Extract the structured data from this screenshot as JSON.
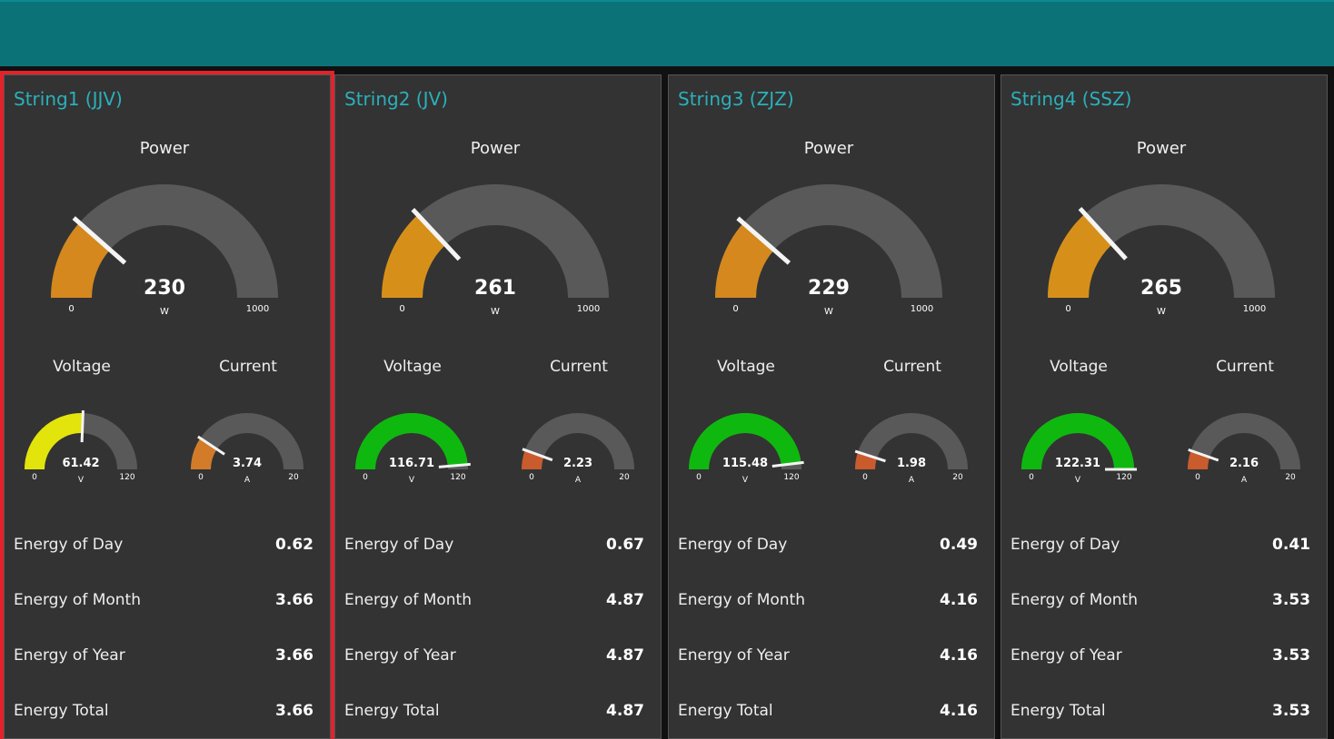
{
  "labels": {
    "power": "Power",
    "voltage": "Voltage",
    "current": "Current",
    "day": "Energy of Day",
    "month": "Energy of Month",
    "year": "Energy of Year",
    "total": "Energy Total"
  },
  "colors": {
    "header": "#0b7378",
    "title": "#2bb0bb",
    "track": "#595959",
    "selection": "#e3222a"
  },
  "strings": [
    {
      "title": "String1 (JJV)",
      "selected": true,
      "power": {
        "value": 230,
        "display": "230",
        "unit": "W",
        "min": "0",
        "max": "1000",
        "maxv": 1000,
        "color": "#d4881e"
      },
      "voltage": {
        "value": 61.42,
        "display": "61.42",
        "unit": "V",
        "min": "0",
        "max": "120",
        "maxv": 120,
        "color": "#e2e40b"
      },
      "current": {
        "value": 3.74,
        "display": "3.74",
        "unit": "A",
        "min": "0",
        "max": "20",
        "maxv": 20,
        "color": "#d27c2a"
      },
      "energy": {
        "day": "0.62",
        "month": "3.66",
        "year": "3.66",
        "total": "3.66"
      }
    },
    {
      "title": "String2 (JV)",
      "selected": false,
      "power": {
        "value": 261,
        "display": "261",
        "unit": "W",
        "min": "0",
        "max": "1000",
        "maxv": 1000,
        "color": "#d69019"
      },
      "voltage": {
        "value": 116.71,
        "display": "116.71",
        "unit": "V",
        "min": "0",
        "max": "120",
        "maxv": 120,
        "color": "#0fb80f"
      },
      "current": {
        "value": 2.23,
        "display": "2.23",
        "unit": "A",
        "min": "0",
        "max": "20",
        "maxv": 20,
        "color": "#c95b2d"
      },
      "energy": {
        "day": "0.67",
        "month": "4.87",
        "year": "4.87",
        "total": "4.87"
      }
    },
    {
      "title": "String3 (ZJZ)",
      "selected": false,
      "power": {
        "value": 229,
        "display": "229",
        "unit": "W",
        "min": "0",
        "max": "1000",
        "maxv": 1000,
        "color": "#d4881e"
      },
      "voltage": {
        "value": 115.48,
        "display": "115.48",
        "unit": "V",
        "min": "0",
        "max": "120",
        "maxv": 120,
        "color": "#0fb80f"
      },
      "current": {
        "value": 1.98,
        "display": "1.98",
        "unit": "A",
        "min": "0",
        "max": "20",
        "maxv": 20,
        "color": "#c95b2d"
      },
      "energy": {
        "day": "0.49",
        "month": "4.16",
        "year": "4.16",
        "total": "4.16"
      }
    },
    {
      "title": "String4 (SSZ)",
      "selected": false,
      "power": {
        "value": 265,
        "display": "265",
        "unit": "W",
        "min": "0",
        "max": "1000",
        "maxv": 1000,
        "color": "#d69019"
      },
      "voltage": {
        "value": 122.31,
        "display": "122.31",
        "unit": "V",
        "min": "0",
        "max": "120",
        "maxv": 120,
        "color": "#0fb80f"
      },
      "current": {
        "value": 2.16,
        "display": "2.16",
        "unit": "A",
        "min": "0",
        "max": "20",
        "maxv": 20,
        "color": "#c95b2d"
      },
      "energy": {
        "day": "0.41",
        "month": "3.53",
        "year": "3.53",
        "total": "3.53"
      }
    }
  ]
}
